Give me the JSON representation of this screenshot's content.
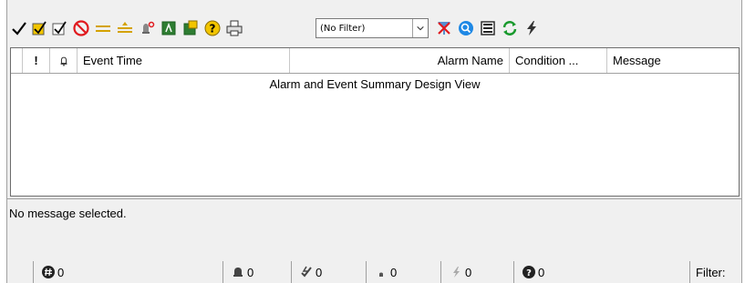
{
  "toolbar": {
    "filter": {
      "value": "(No Filter)"
    },
    "buttons": [
      "acknowledge-icon",
      "acknowledge-selected-icon",
      "acknowledge-all-icon",
      "silence-icon",
      "shelve-icon",
      "suppress-icon",
      "alarm-details-icon",
      "export-icon",
      "settings-icon",
      "help-icon",
      "print-icon",
      "clear-filter-icon",
      "find-icon",
      "details-view-icon",
      "refresh-icon",
      "lightning-icon"
    ]
  },
  "grid": {
    "columns": {
      "priority": "!",
      "bell": "",
      "event_time": "Event Time",
      "alarm_name": "Alarm Name",
      "condition": "Condition ...",
      "message": "Message"
    },
    "design_view_text": "Alarm and Event Summary Design View"
  },
  "message_area": {
    "text": "No message selected."
  },
  "status": {
    "total_count": "0",
    "in_alarm_count": "0",
    "unack_count": "0",
    "return_to_normal_count": "0",
    "faulted_count": "0",
    "shelved_count": "0",
    "filter_label": "Filter:"
  },
  "colors": {
    "accent_red": "#e0191e",
    "accent_green": "#1a9a2e",
    "accent_blue": "#1565c0",
    "icon_yellow": "#f2c500"
  }
}
